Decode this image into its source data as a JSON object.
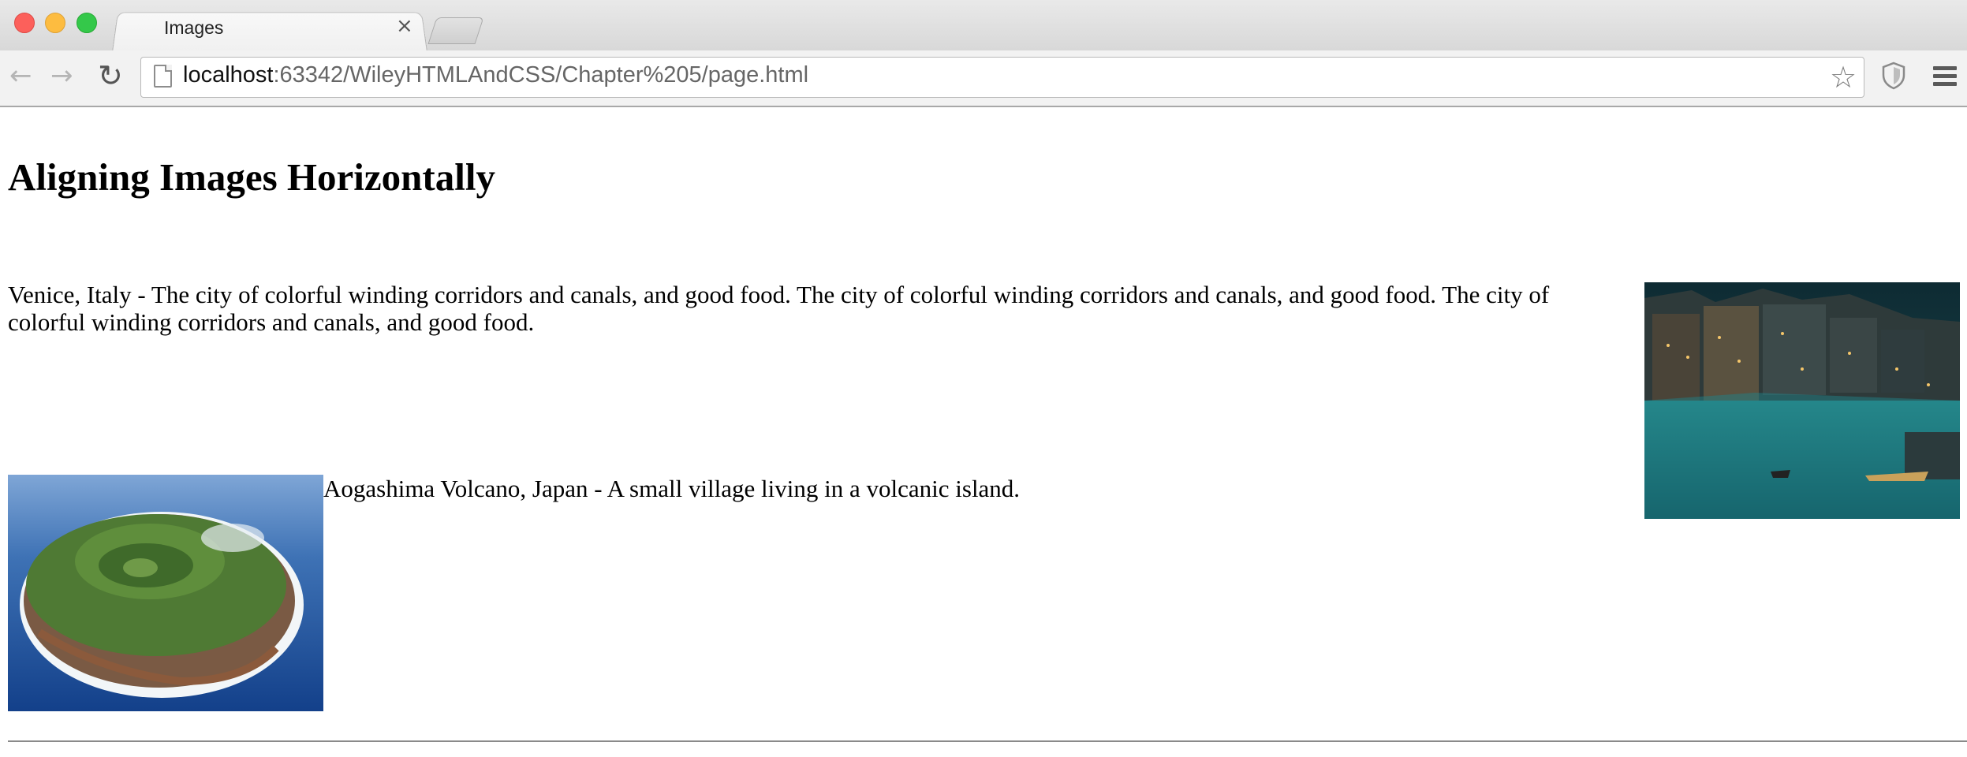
{
  "browser": {
    "tab_title": "Images",
    "tab_close": "×",
    "url_host": "localhost",
    "url_path": ":63342/WileyHTMLAndCSS/Chapter%205/page.html",
    "icons": {
      "back": "arrow-left-icon",
      "forward": "arrow-right-icon",
      "reload": "reload-icon",
      "bookmark": "star-icon",
      "extension": "shield-icon",
      "menu": "hamburger-menu-icon"
    }
  },
  "page": {
    "heading": "Aligning Images Horizontally",
    "venice_text": "Venice, Italy - The city of colorful winding corridors and canals, and good food. The city of colorful winding corridors and canals, and good food. The city of colorful winding corridors and canals, and good food.",
    "aogashima_text": "Aogashima Volcano, Japan - A small village living in a volcanic island."
  },
  "colors": {
    "close": "#fc605b",
    "minimize": "#fdbc40",
    "maximize": "#34c84a",
    "canal_water": "#1f7f86",
    "ocean": "#1e5ea8"
  }
}
